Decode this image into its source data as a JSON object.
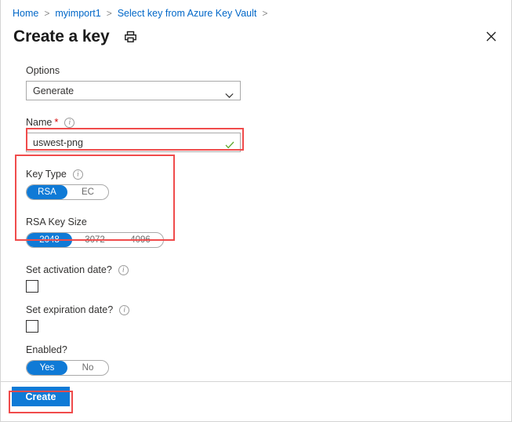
{
  "breadcrumb": {
    "items": [
      "Home",
      "myimport1",
      "Select key from Azure Key Vault"
    ],
    "separator": ">"
  },
  "header": {
    "title": "Create a key",
    "print_icon": "printer-icon",
    "close_icon": "close-icon"
  },
  "form": {
    "options": {
      "label": "Options",
      "value": "Generate",
      "chevron": "chevron-down-icon"
    },
    "name": {
      "label": "Name",
      "required_marker": "*",
      "info": "i",
      "value": "uswest-png",
      "validation_icon": "checkmark-icon"
    },
    "key_type": {
      "label": "Key Type",
      "info": "i",
      "options": [
        "RSA",
        "EC"
      ],
      "selected": "RSA"
    },
    "rsa_key_size": {
      "label": "RSA Key Size",
      "options": [
        "2048",
        "3072",
        "4096"
      ],
      "selected": "2048"
    },
    "set_activation_date": {
      "label": "Set activation date?",
      "info": "i",
      "checked": false
    },
    "set_expiration_date": {
      "label": "Set expiration date?",
      "info": "i",
      "checked": false
    },
    "enabled": {
      "label": "Enabled?",
      "options": [
        "Yes",
        "No"
      ],
      "selected": "Yes"
    }
  },
  "footer": {
    "create_label": "Create"
  },
  "colors": {
    "accent_blue": "#0f7ad6",
    "link_blue": "#0067c8",
    "highlight_red": "#f04b4b",
    "required_red": "#d40000",
    "valid_green": "#5ea82c",
    "border_gray": "#a9a9a9"
  }
}
